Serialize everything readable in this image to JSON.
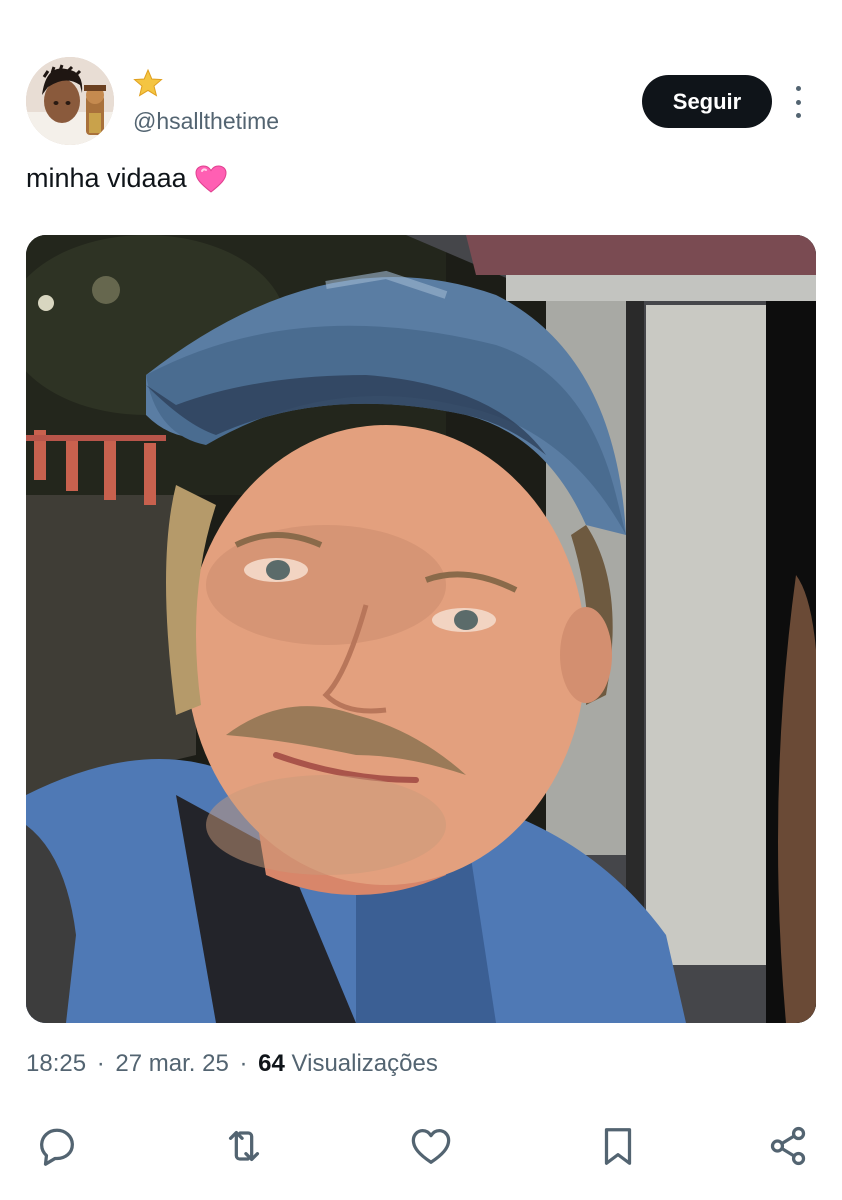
{
  "header": {
    "badge_icon": "star-emoji",
    "handle": "@hsallthetime",
    "follow_label": "Seguir",
    "more_icon": "more-vertical-icon"
  },
  "tweet": {
    "text": "minha vidaaa",
    "emoji_icon": "pink-heart-emoji"
  },
  "meta": {
    "time": "18:25",
    "separator": "·",
    "date": "27 mar. 25",
    "views_count": "64",
    "views_label": "Visualizações"
  },
  "actions": [
    {
      "icon": "reply-icon"
    },
    {
      "icon": "retweet-icon"
    },
    {
      "icon": "like-icon"
    },
    {
      "icon": "bookmark-icon"
    },
    {
      "icon": "share-icon"
    }
  ],
  "colors": {
    "text": "#0f1419",
    "secondary": "#536471",
    "button_bg": "#0f1419",
    "button_text": "#ffffff",
    "heart_pink": "#ff5fb3",
    "star_gold": "#f4c542"
  }
}
